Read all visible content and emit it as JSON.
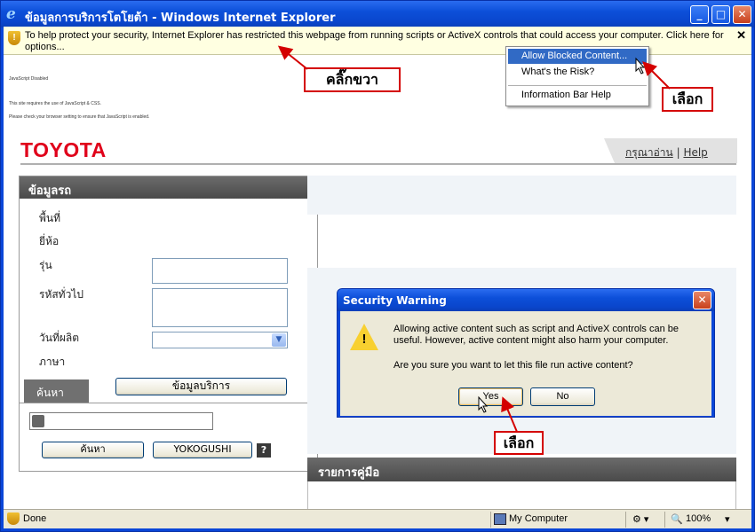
{
  "window": {
    "title": "ข้อมูลการบริการโตโยต้า - Windows Internet Explorer",
    "min_label": "_",
    "max_label": "□",
    "close_label": "✕"
  },
  "infobar": {
    "message": "To help protect your security, Internet Explorer has restricted this webpage from running scripts or ActiveX controls that could access your computer. Click here for options...",
    "close_label": "✕"
  },
  "context_menu": {
    "items": [
      "Allow Blocked Content...",
      "What's the Risk?",
      "Information Bar Help"
    ]
  },
  "page": {
    "js_disabled": "JavaScript Disabled",
    "js_required": "This site requires the use of JavaScript & CSS.",
    "js_check": "Please check your browser setting to ensure that JavaScript is enabled.",
    "logo": "TOYOTA",
    "link_read": "กรุณาอ่าน",
    "link_sep": "|",
    "link_help": "Help"
  },
  "vehicle_panel": {
    "title": "ข้อมูลรถ",
    "labels": [
      "พื้นที่",
      "ยี่ห้อ",
      "รุ่น",
      "รหัสทั่วไป",
      "วันที่ผลิต",
      "ภาษา"
    ],
    "tab_search": "ค้นหา",
    "service_button": "ข้อมูลบริการ",
    "search_button": "ค้นหา",
    "yokogushi_button": "YOKOGUSHI",
    "help_label": "?"
  },
  "manual_panel": {
    "title": "รายการคู่มือ"
  },
  "dialog": {
    "title": "Security Warning",
    "close_label": "✕",
    "warn_mark": "!",
    "message": "Allowing active content such as script and ActiveX controls can be useful. However, active content might also harm your computer.",
    "question": "Are you sure you want to let this file run active content?",
    "yes_label": "Yes",
    "no_label": "No"
  },
  "annotations": {
    "right_click": "คลิ๊กขวา",
    "select_menu": "เลือก",
    "select_yes": "เลือก"
  },
  "statusbar": {
    "status": "Done",
    "zone": "My Computer",
    "zoom": "100%"
  },
  "colors": {
    "toyota_red": "#e0001a",
    "annotation_red": "#d40000",
    "menu_highlight": "#316ac5"
  }
}
